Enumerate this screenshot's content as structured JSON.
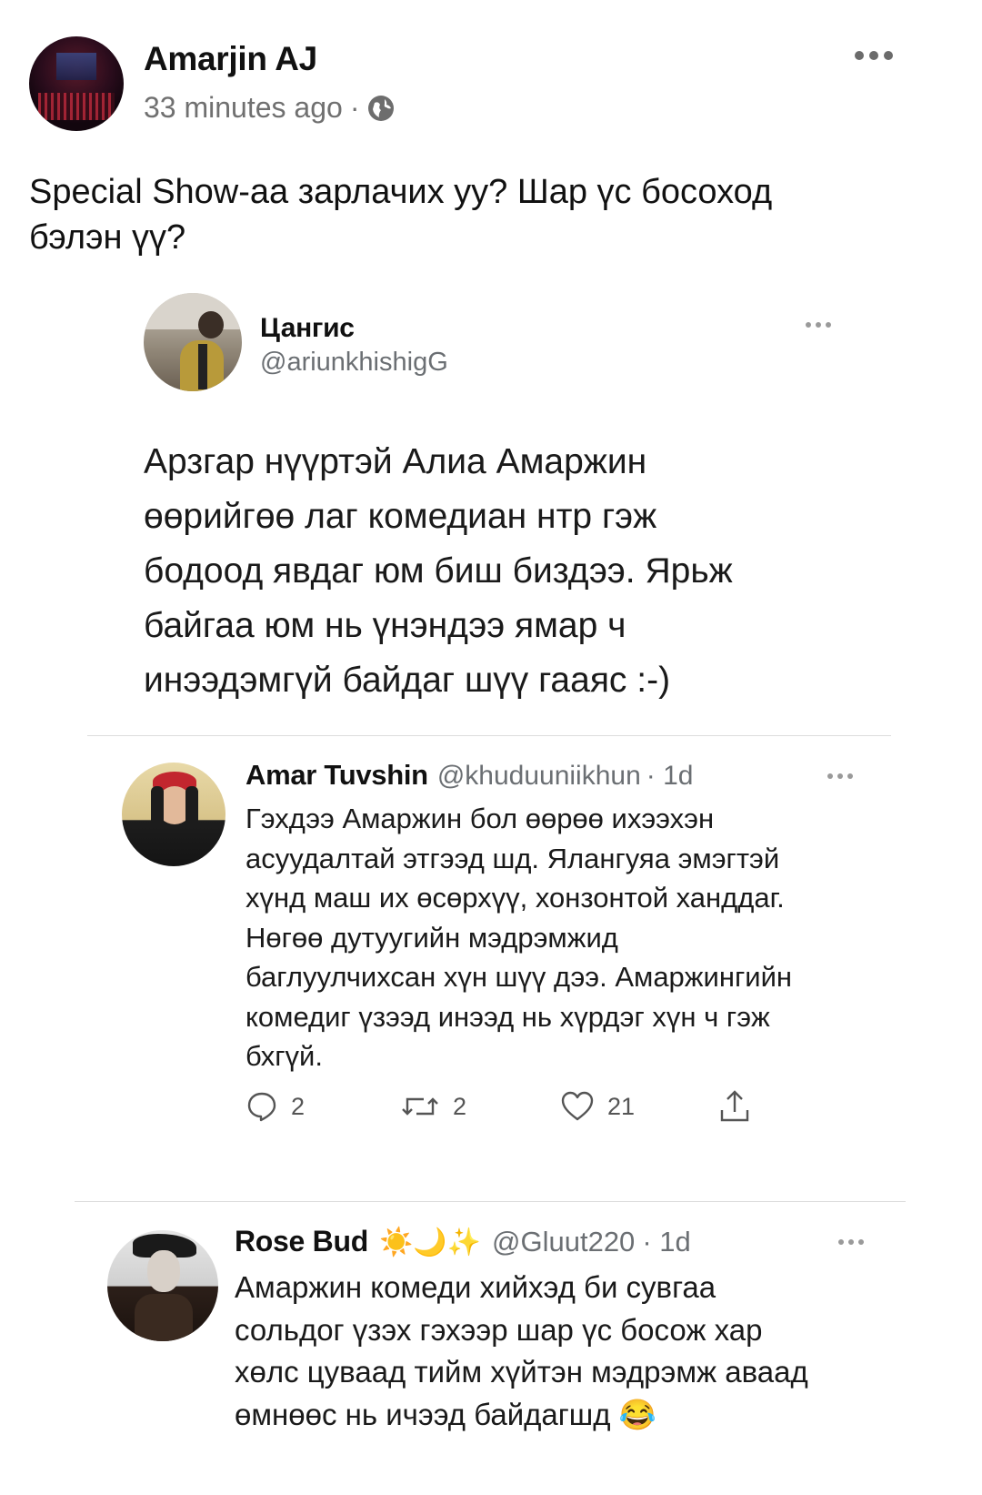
{
  "post": {
    "author": "Amarjin AJ",
    "timestamp": "33 minutes ago",
    "separator": "·",
    "globe_icon": "globe-icon",
    "more_icon": "more-horizontal-icon",
    "text_line1": "Special Show-аа зарлачих уу? Шар үс босоход",
    "text_line2": "бэлэн үү?"
  },
  "tweet": {
    "name": "Цангис",
    "handle": "@ariunkhishigG",
    "lines": [
      "Арзгар нүүртэй Алиа Амаржин",
      "өөрийгөө лаг комедиан нтр гэж",
      "бодоод явдаг юм биш биздээ. Ярьж",
      "байгаа юм нь үнэндээ ямар ч",
      "инээдэмгүй байдаг шүү гааяс :-)"
    ]
  },
  "replies": [
    {
      "name": "Amar Tuvshin",
      "handle": "@khuduuniikhun",
      "time": "· 1d",
      "lines": [
        "Гэхдээ Амаржин бол өөрөө ихээхэн",
        "асуудалтай этгээд шд. Ялангуяа эмэгтэй",
        "хүнд маш их өсөрхүү, хонзонтой ханддаг.",
        "Нөгөө дутуугийн мэдрэмжид",
        "баглуулчихсан хүн шүү дээ. Амаржингийн",
        "комедиг үзээд инээд нь хүрдэг хүн ч гэж",
        "бхгүй."
      ],
      "actions": {
        "replies": "2",
        "retweets": "2",
        "likes": "21"
      }
    },
    {
      "name": "Rose Bud",
      "emoji": "☀️🌙✨",
      "handle": "@Gluut220",
      "time": "· 1d",
      "lines": [
        "Амаржин  комеди хийхэд би сувгаа",
        "сольдог үзэх гэхээр шар үс босож хар",
        "хөлс цуваад тийм хүйтэн мэдрэмж аваад",
        "өмнөөс нь ичээд байдагшд 😂"
      ]
    }
  ]
}
